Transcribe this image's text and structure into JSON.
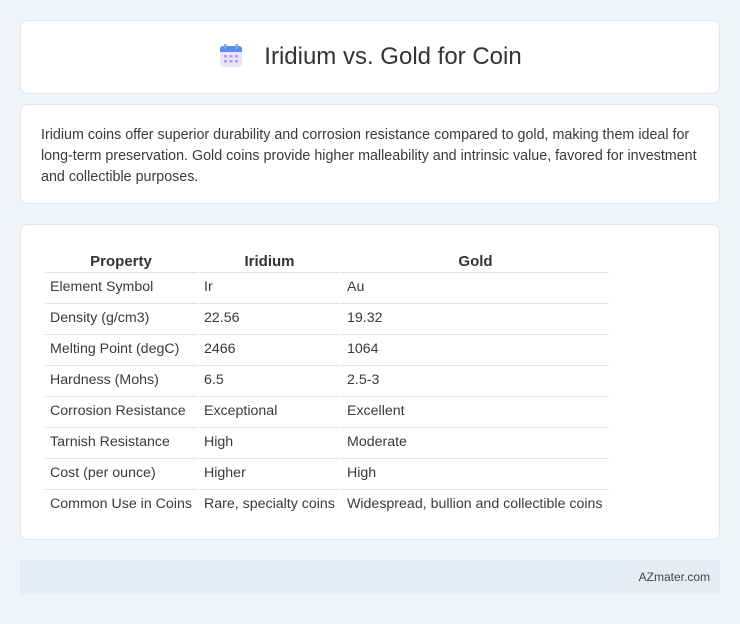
{
  "header": {
    "title": "Iridium vs. Gold for Coin",
    "icon": "calendar-icon"
  },
  "summary": {
    "text": "Iridium coins offer superior durability and corrosion resistance compared to gold, making them ideal for long-term preservation. Gold coins provide higher malleability and intrinsic value, favored for investment and collectible purposes."
  },
  "table": {
    "headers": [
      "Property",
      "Iridium",
      "Gold"
    ],
    "rows": [
      [
        "Element Symbol",
        "Ir",
        "Au"
      ],
      [
        "Density (g/cm3)",
        "22.56",
        "19.32"
      ],
      [
        "Melting Point (degC)",
        "2466",
        "1064"
      ],
      [
        "Hardness (Mohs)",
        "6.5",
        "2.5-3"
      ],
      [
        "Corrosion Resistance",
        "Exceptional",
        "Excellent"
      ],
      [
        "Tarnish Resistance",
        "High",
        "Moderate"
      ],
      [
        "Cost (per ounce)",
        "Higher",
        "High"
      ],
      [
        "Common Use in Coins",
        "Rare, specialty coins",
        "Widespread, bullion and collectible coins"
      ]
    ]
  },
  "footer": {
    "site": "AZmater.com"
  },
  "colors": {
    "background": "#f0f3f8",
    "card": "#ffffff",
    "footer": "#e6ecf5",
    "icon_accent": "#5b8def"
  }
}
